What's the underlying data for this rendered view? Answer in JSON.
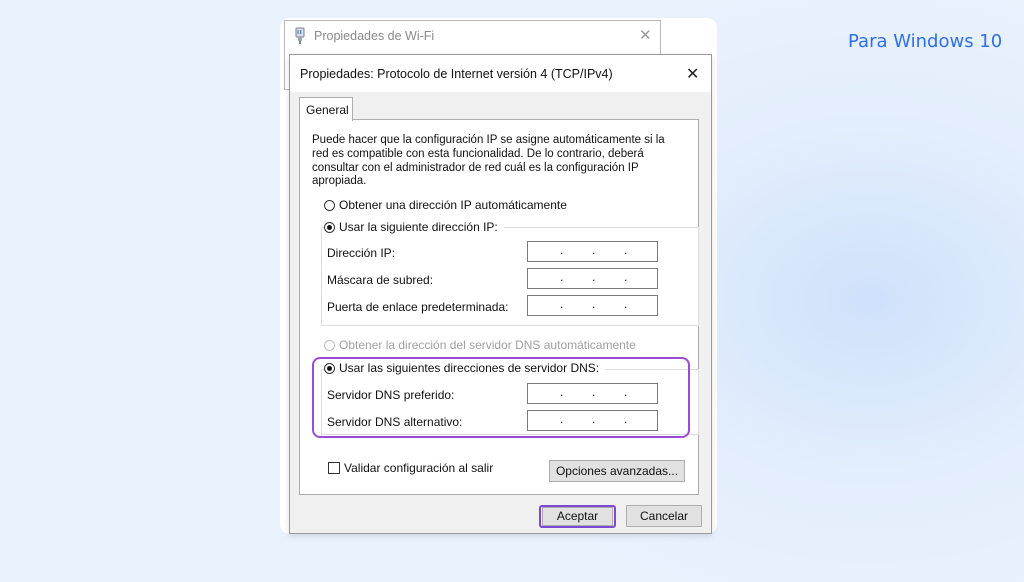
{
  "corner_label": "Para Windows 10",
  "back_window": {
    "title": "Propiedades de Wi-Fi",
    "close_glyph": "✕"
  },
  "dialog": {
    "title": "Propiedades: Protocolo de Internet versión 4 (TCP/IPv4)",
    "close_glyph": "✕",
    "tab": "General",
    "intro": "Puede hacer que la configuración IP se asigne automáticamente si la red es compatible con esta funcionalidad. De lo contrario, deberá consultar con el administrador de red cuál es la configuración IP apropiada.",
    "ip": {
      "auto_label": "Obtener una dirección IP automáticamente",
      "manual_label": "Usar la siguiente dirección IP:",
      "fields": [
        {
          "label": "Dirección IP:",
          "value": ". . ."
        },
        {
          "label": "Máscara de subred:",
          "value": ". . ."
        },
        {
          "label": "Puerta de enlace predeterminada:",
          "value": ". . ."
        }
      ]
    },
    "dns": {
      "auto_label": "Obtener la dirección del servidor DNS automáticamente",
      "manual_label": "Usar las siguientes direcciones de servidor DNS:",
      "fields": [
        {
          "label": "Servidor DNS preferido:",
          "value": ". . ."
        },
        {
          "label": "Servidor DNS alternativo:",
          "value": ". . ."
        }
      ]
    },
    "validate_label": "Validar configuración al salir",
    "advanced_button": "Opciones avanzadas...",
    "ok_button": "Aceptar",
    "cancel_button": "Cancelar"
  },
  "colors": {
    "highlight": "#9b4bd8",
    "accent_text": "#2f6fe8"
  }
}
